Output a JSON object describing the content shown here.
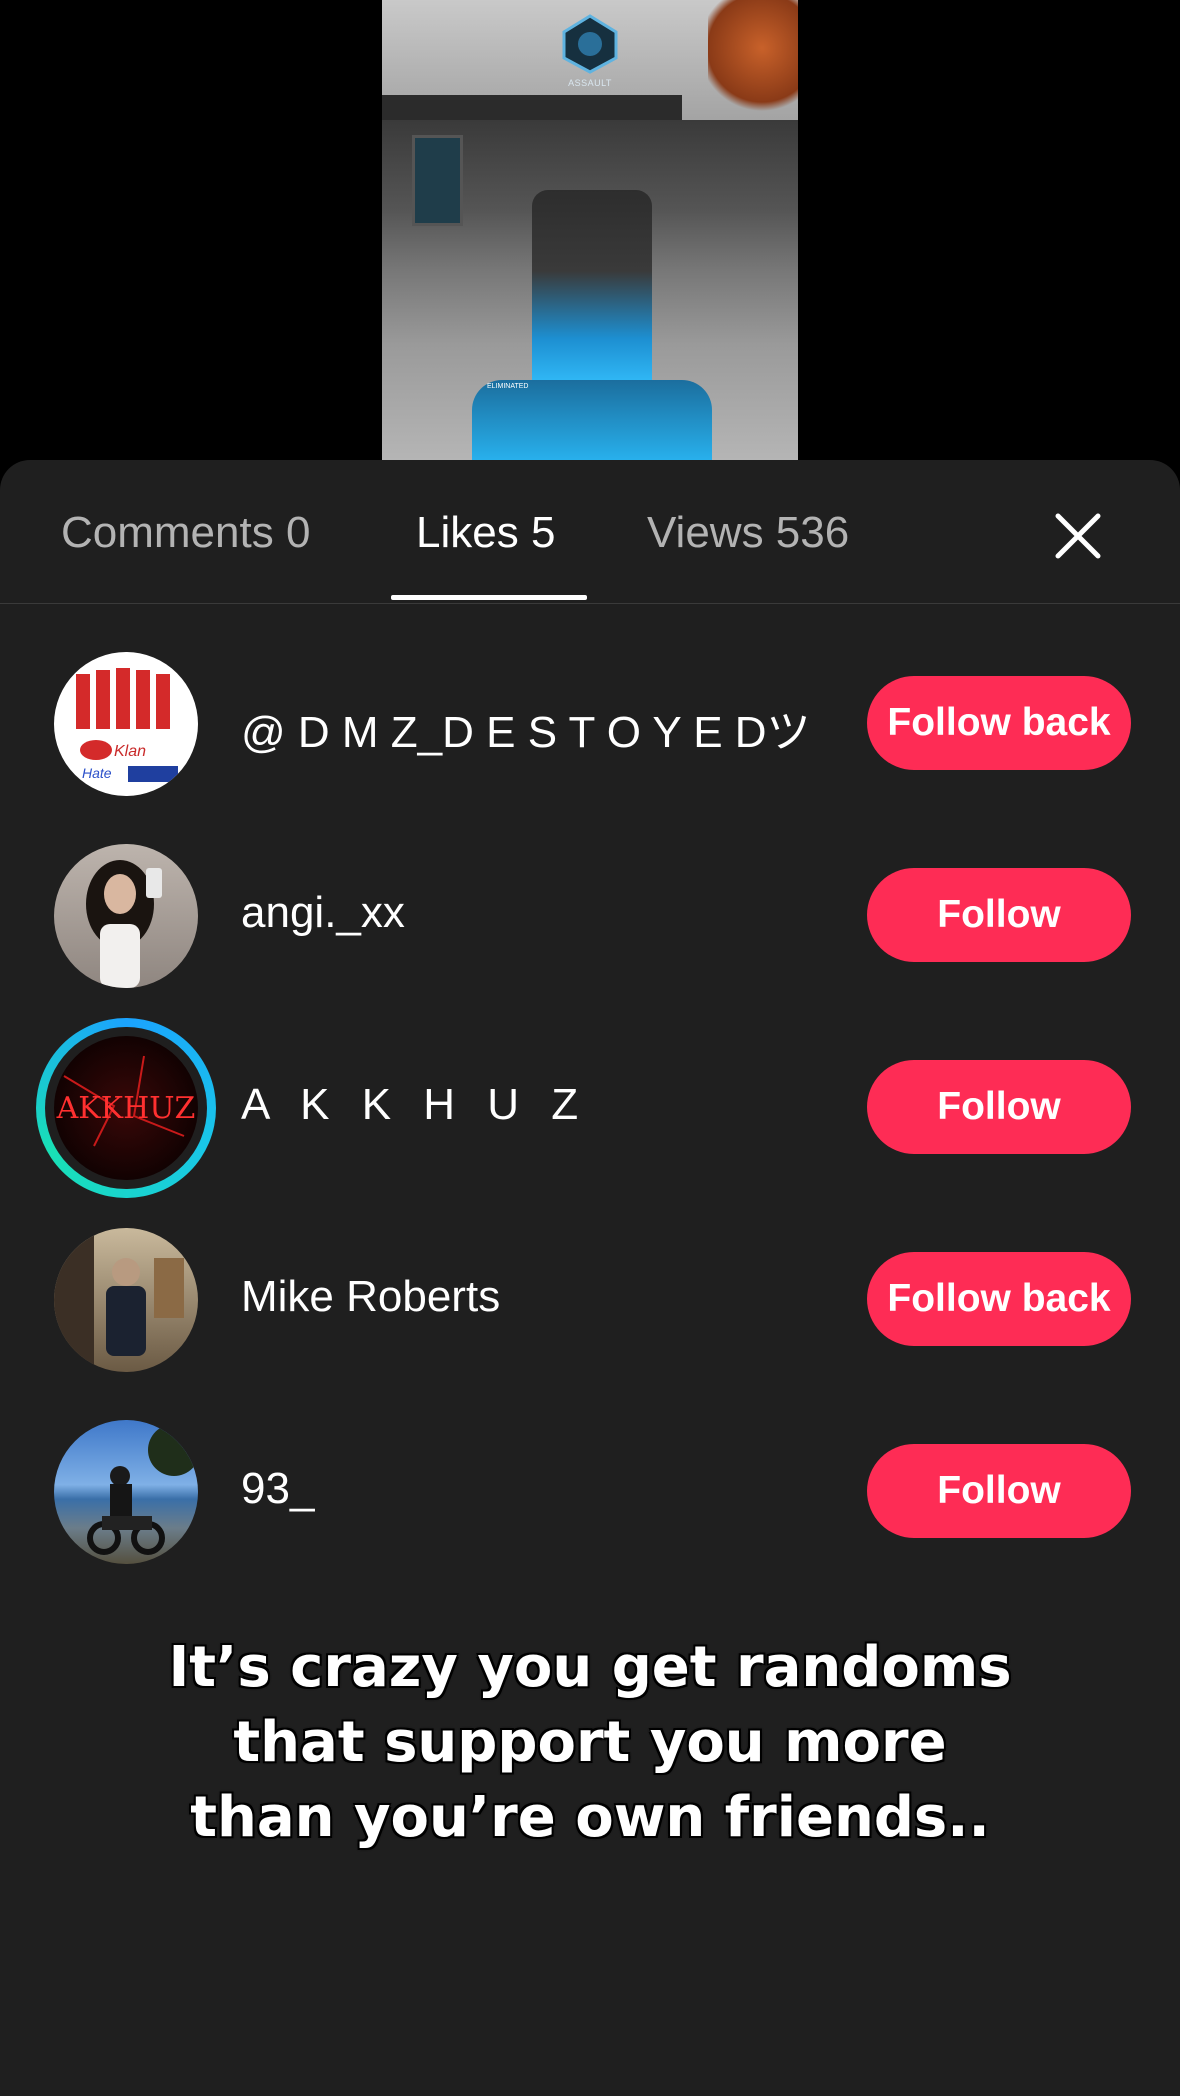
{
  "video": {
    "emblem_label": "ASSAULT",
    "kill_feed": "ELIMINATED"
  },
  "tabs": [
    {
      "label": "Comments 0",
      "active": false
    },
    {
      "label": "Likes 5",
      "active": true
    },
    {
      "label": "Views 536",
      "active": false
    }
  ],
  "likes": [
    {
      "username": "@ D M Z_D E S T O Y E Dツ",
      "button": "Follow back",
      "avatar_text": [
        "Klan",
        "Hate"
      ],
      "avatar_icon": "kitkat-avatar"
    },
    {
      "username": "angi._xx",
      "button": "Follow",
      "avatar_icon": "selfie-avatar"
    },
    {
      "username": "A K K H U Z",
      "button": "Follow",
      "avatar_text": [
        "AKKHUZ"
      ],
      "avatar_icon": "akkhuz-logo-avatar",
      "has_story_ring": true
    },
    {
      "username": "Mike Roberts",
      "button": "Follow back",
      "avatar_icon": "man-photo-avatar"
    },
    {
      "username": "93_",
      "button": "Follow",
      "avatar_icon": "motorcycle-avatar"
    }
  ],
  "caption": [
    "It’s crazy you get randoms",
    "that support you more",
    "than you’re own friends.."
  ],
  "colors": {
    "sheet_bg": "#1f1f1f",
    "button": "#fe2c55",
    "ring_start": "#1ba3ff",
    "ring_end": "#19e0b5"
  }
}
